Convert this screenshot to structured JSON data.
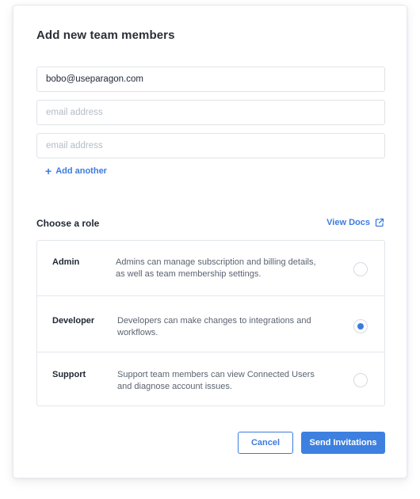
{
  "modal": {
    "title": "Add new team members"
  },
  "emails": {
    "values": [
      "bobo@useparagon.com",
      "",
      ""
    ],
    "placeholder": "email address",
    "add_another_label": "Add another",
    "add_icon": "plus-icon"
  },
  "roles": {
    "section_label": "Choose a role",
    "view_docs_label": "View Docs",
    "view_docs_icon": "external-link-icon",
    "selected": "Developer",
    "items": [
      {
        "name": "Admin",
        "description": "Admins can manage subscription and billing details, as well as team membership settings.",
        "selected": false
      },
      {
        "name": "Developer",
        "description": "Developers can make changes to integrations and workflows.",
        "selected": true
      },
      {
        "name": "Support",
        "description": "Support team members can view Connected Users and diagnose account issues.",
        "selected": false
      }
    ]
  },
  "actions": {
    "cancel_label": "Cancel",
    "send_label": "Send Invitations"
  },
  "colors": {
    "accent": "#3c7be0",
    "border": "#e3e6eb",
    "text": "#1f2733",
    "muted_text": "#5b6370",
    "placeholder": "#b5bcc6"
  }
}
